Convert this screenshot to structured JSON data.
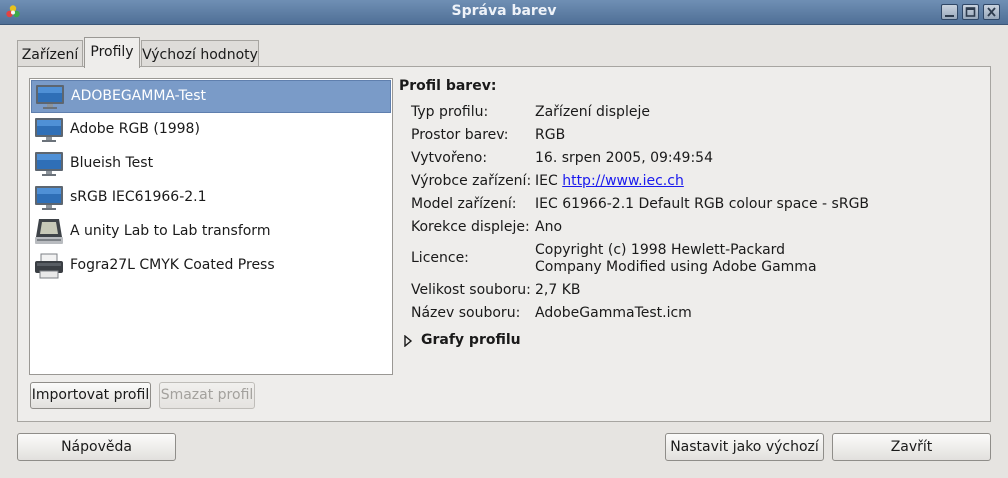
{
  "window": {
    "title": "Správa barev"
  },
  "tabs": [
    {
      "label": "Zařízení"
    },
    {
      "label": "Profily"
    },
    {
      "label": "Výchozí hodnoty"
    }
  ],
  "profiles": [
    {
      "name": "ADOBEGAMMA-Test",
      "icon": "monitor-icon"
    },
    {
      "name": "Adobe RGB (1998)",
      "icon": "monitor-icon"
    },
    {
      "name": "Blueish Test",
      "icon": "monitor-icon"
    },
    {
      "name": "sRGB IEC61966-2.1",
      "icon": "monitor-icon"
    },
    {
      "name": "A unity Lab to Lab transform",
      "icon": "scanner-icon"
    },
    {
      "name": "Fogra27L CMYK Coated Press",
      "icon": "printer-icon"
    }
  ],
  "list_buttons": {
    "import": "Importovat profil",
    "delete": "Smazat profil"
  },
  "details": {
    "title": "Profil barev:",
    "rows": [
      {
        "key": "Typ profilu:",
        "value": "Zařízení displeje"
      },
      {
        "key": "Prostor barev:",
        "value": "RGB"
      },
      {
        "key": "Vytvořeno:",
        "value": "16. srpen 2005, 09:49:54"
      },
      {
        "key": "Výrobce zařízení:",
        "value_prefix": "IEC ",
        "link": "http://www.iec.ch"
      },
      {
        "key": "Model zařízení:",
        "value": "IEC 61966-2.1 Default RGB colour space - sRGB"
      },
      {
        "key": "Korekce displeje:",
        "value": "Ano"
      },
      {
        "key": "Licence:",
        "value_line1": "Copyright (c) 1998 Hewlett-Packard",
        "value_line2": "Company Modified using Adobe Gamma"
      },
      {
        "key": "Velikost souboru:",
        "value": "2,7 KB"
      },
      {
        "key": "Název souboru:",
        "value": "AdobeGammaTest.icm"
      }
    ],
    "expander_label": "Grafy profilu"
  },
  "footer": {
    "help": "Nápověda",
    "set_default": "Nastavit jako výchozí",
    "close": "Zavřít"
  },
  "colors": {
    "titlebar": "#5b7ba2",
    "selection": "#7a9bc8",
    "link": "#1a1aee"
  }
}
